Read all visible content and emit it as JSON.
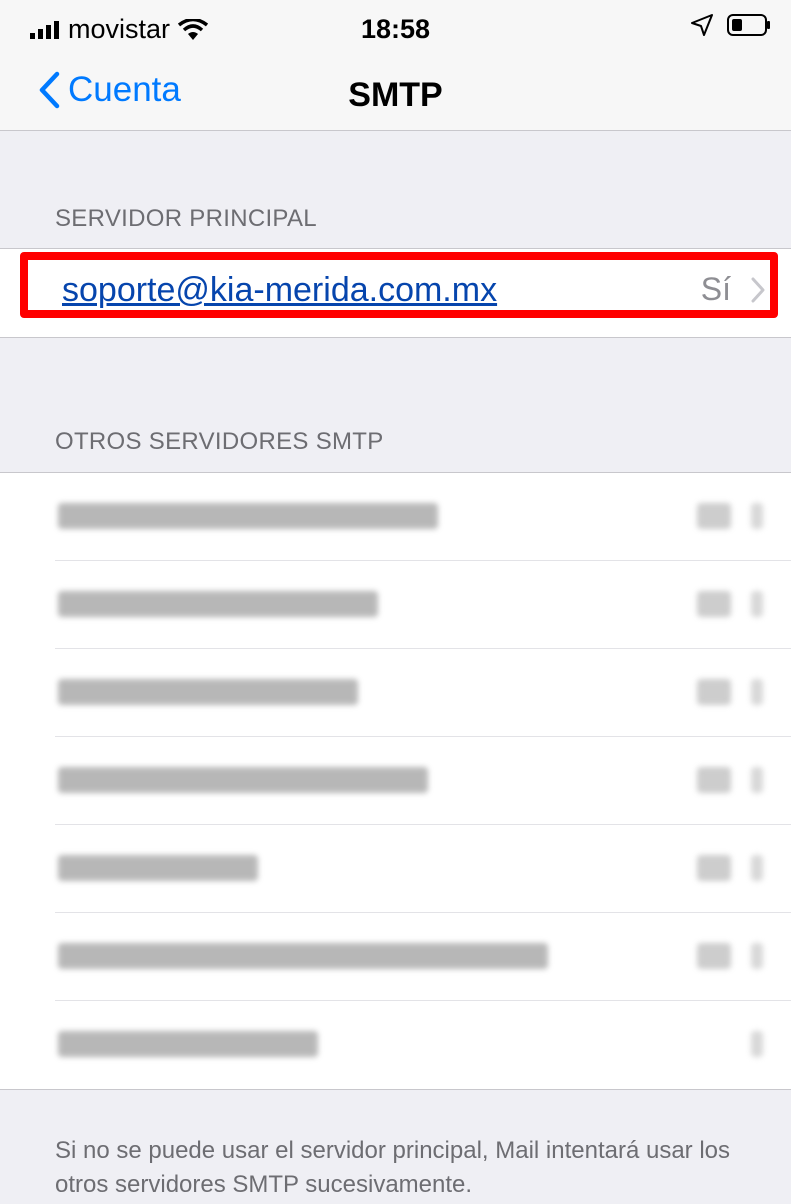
{
  "status_bar": {
    "carrier": "movistar",
    "time": "18:58"
  },
  "nav": {
    "back_label": "Cuenta",
    "title": "SMTP"
  },
  "primary_section": {
    "header": "SERVIDOR PRINCIPAL",
    "server": "soporte@kia-merida.com.mx",
    "value": "Sí"
  },
  "other_section": {
    "header": "OTROS SERVIDORES SMTP",
    "rows": [
      "",
      "",
      "",
      "",
      "",
      "",
      ""
    ]
  },
  "footer_note": "Si no se puede usar el servidor principal, Mail intentará usar los otros servidores SMTP sucesivamente.",
  "colors": {
    "accent": "#007aff",
    "highlight": "#ff0000",
    "background": "#efeff4"
  }
}
